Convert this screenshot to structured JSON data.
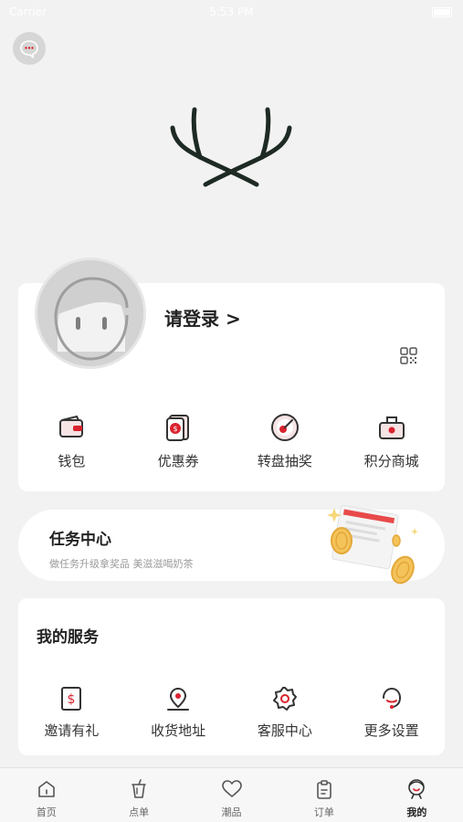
{
  "status_bar": {
    "carrier": "Carrier",
    "time": "5:53 PM"
  },
  "profile": {
    "login_label": "请登录 >"
  },
  "quick_actions": [
    {
      "label": "钱包",
      "icon": "wallet-icon"
    },
    {
      "label": "优惠券",
      "icon": "coupon-icon"
    },
    {
      "label": "转盘抽奖",
      "icon": "lucky-wheel-icon"
    },
    {
      "label": "积分商城",
      "icon": "points-mall-icon"
    }
  ],
  "task_center": {
    "title": "任务中心",
    "subtitle": "做任务升级拿奖品 美滋滋喝奶茶"
  },
  "services": {
    "title": "我的服务",
    "items": [
      {
        "label": "邀请有礼",
        "icon": "invite-icon"
      },
      {
        "label": "收货地址",
        "icon": "address-pin-icon"
      },
      {
        "label": "客服中心",
        "icon": "customer-service-icon"
      },
      {
        "label": "更多设置",
        "icon": "settings-icon"
      }
    ]
  },
  "tabbar": {
    "items": [
      {
        "label": "首页",
        "icon": "home-icon"
      },
      {
        "label": "点单",
        "icon": "cup-icon"
      },
      {
        "label": "潮品",
        "icon": "heart-icon"
      },
      {
        "label": "订单",
        "icon": "clipboard-icon"
      },
      {
        "label": "我的",
        "icon": "user-icon",
        "active": true
      }
    ]
  },
  "colors": {
    "accent": "#d9232e",
    "background": "#f2f2f2",
    "card": "#ffffff"
  }
}
